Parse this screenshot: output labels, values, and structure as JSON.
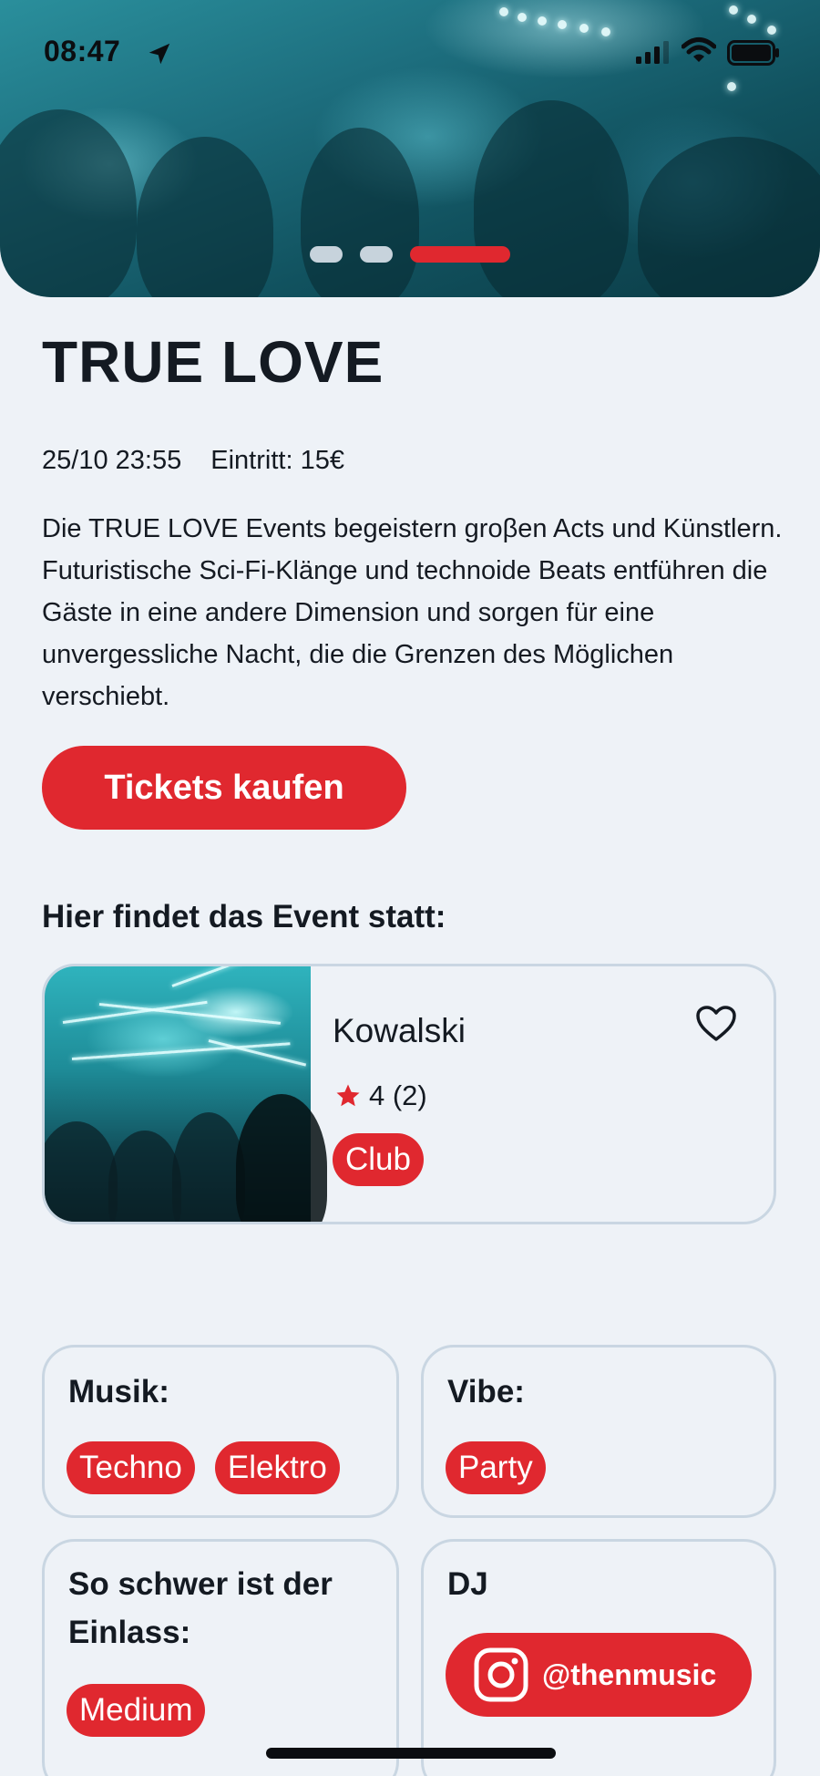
{
  "status_bar": {
    "time": "08:47"
  },
  "hero": {
    "slides_total": 3,
    "active_slide": 3
  },
  "event": {
    "title": "TRUE LOVE",
    "datetime": "25/10 23:55",
    "entry": "Eintritt: 15€",
    "description": "Die TRUE LOVE Events begeistern groβen Acts und Künstlern. Futuristische Sci-Fi-Klänge und technoide Beats entführen die Gäste in eine andere Dimension und sorgen für eine unvergessliche Nacht, die die Grenzen des Möglichen verschiebt.",
    "tickets_label": "Tickets kaufen"
  },
  "venue_section": {
    "heading": "Hier findet das Event statt:",
    "venue": {
      "name": "Kowalski",
      "rating": "4 (2)",
      "tag": "Club"
    }
  },
  "cards": {
    "music": {
      "label": "Musik:",
      "tags": [
        "Techno",
        "Elektro"
      ]
    },
    "vibe": {
      "label": "Vibe:",
      "tags": [
        "Party"
      ]
    },
    "entry_difficulty": {
      "label": "So schwer ist der Einlass:",
      "tags": [
        "Medium"
      ]
    },
    "dj": {
      "label": "DJ",
      "instagram": "@thenmusic"
    }
  },
  "colors": {
    "accent": "#e0282f",
    "background": "#eef2f7",
    "card_border": "#c9d6e2",
    "text": "#141a22"
  }
}
